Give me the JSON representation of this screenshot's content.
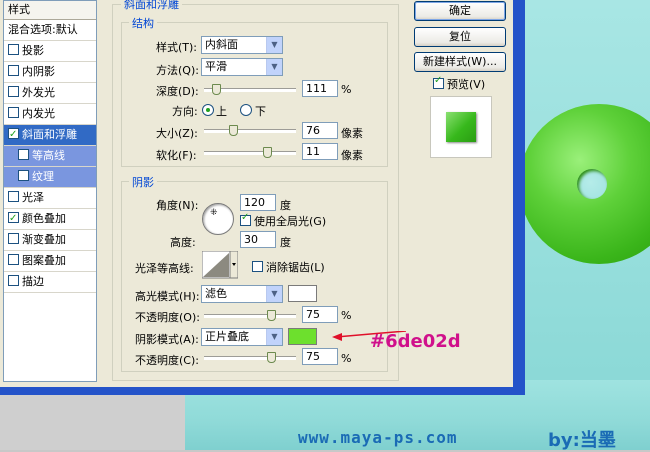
{
  "styles_panel": {
    "header": "样式",
    "items": [
      {
        "label": "混合选项:默认",
        "checkbox": false,
        "checked": false,
        "state": "normal"
      },
      {
        "label": "投影",
        "checkbox": true,
        "checked": false,
        "state": "normal"
      },
      {
        "label": "内阴影",
        "checkbox": true,
        "checked": false,
        "state": "normal"
      },
      {
        "label": "外发光",
        "checkbox": true,
        "checked": false,
        "state": "normal"
      },
      {
        "label": "内发光",
        "checkbox": true,
        "checked": false,
        "state": "normal"
      },
      {
        "label": "斜面和浮雕",
        "checkbox": true,
        "checked": true,
        "state": "selected"
      },
      {
        "label": "等高线",
        "checkbox": true,
        "checked": false,
        "state": "sub"
      },
      {
        "label": "纹理",
        "checkbox": true,
        "checked": false,
        "state": "sub"
      },
      {
        "label": "光泽",
        "checkbox": true,
        "checked": false,
        "state": "normal"
      },
      {
        "label": "颜色叠加",
        "checkbox": true,
        "checked": true,
        "state": "normal"
      },
      {
        "label": "渐变叠加",
        "checkbox": true,
        "checked": false,
        "state": "normal"
      },
      {
        "label": "图案叠加",
        "checkbox": true,
        "checked": false,
        "state": "normal"
      },
      {
        "label": "描边",
        "checkbox": true,
        "checked": false,
        "state": "normal"
      }
    ]
  },
  "bevel": {
    "section_title": "斜面和浮雕",
    "structure_title": "结构",
    "style_label": "样式(T):",
    "style_value": "内斜面",
    "technique_label": "方法(Q):",
    "technique_value": "平滑",
    "depth_label": "深度(D):",
    "depth_value": "111",
    "depth_unit": "%",
    "depth_level": 0.1,
    "direction_label": "方向:",
    "direction_up": "上",
    "direction_down": "下",
    "size_label": "大小(Z):",
    "size_value": "76",
    "size_unit": "像素",
    "size_level": 0.3,
    "soften_label": "软化(F):",
    "soften_value": "11",
    "soften_unit": "像素",
    "soften_level": 0.7
  },
  "shading": {
    "title": "阴影",
    "angle_label": "角度(N):",
    "angle_value": "120",
    "angle_unit": "度",
    "global_light_label": "使用全局光(G)",
    "altitude_label": "高度:",
    "altitude_value": "30",
    "altitude_unit": "度",
    "gloss_contour_label": "光泽等高线:",
    "anti_alias_label": "消除锯齿(L)",
    "highlight_mode_label": "高光模式(H):",
    "highlight_mode_value": "滤色",
    "highlight_color": "#ffffff",
    "highlight_opacity_label": "不透明度(O):",
    "highlight_opacity_value": "75",
    "highlight_opacity_level": 0.75,
    "shadow_mode_label": "阴影模式(A):",
    "shadow_mode_value": "正片叠底",
    "shadow_color": "#6de02d",
    "shadow_opacity_label": "不透明度(C):",
    "shadow_opacity_value": "75",
    "shadow_opacity_level": 0.75,
    "percent": "%"
  },
  "buttons": {
    "ok": "确定",
    "reset": "复位",
    "new_style": "新建样式(W)...",
    "preview_label": "预览(V)"
  },
  "annotation": {
    "hex_label": "#6de02d"
  },
  "footer": {
    "url": "www.maya-ps.com",
    "author": "by:当墨"
  },
  "colors": {
    "selection": "#316ac5",
    "accent_arrow": "#e0102a",
    "donut_green": "#4cc528"
  }
}
